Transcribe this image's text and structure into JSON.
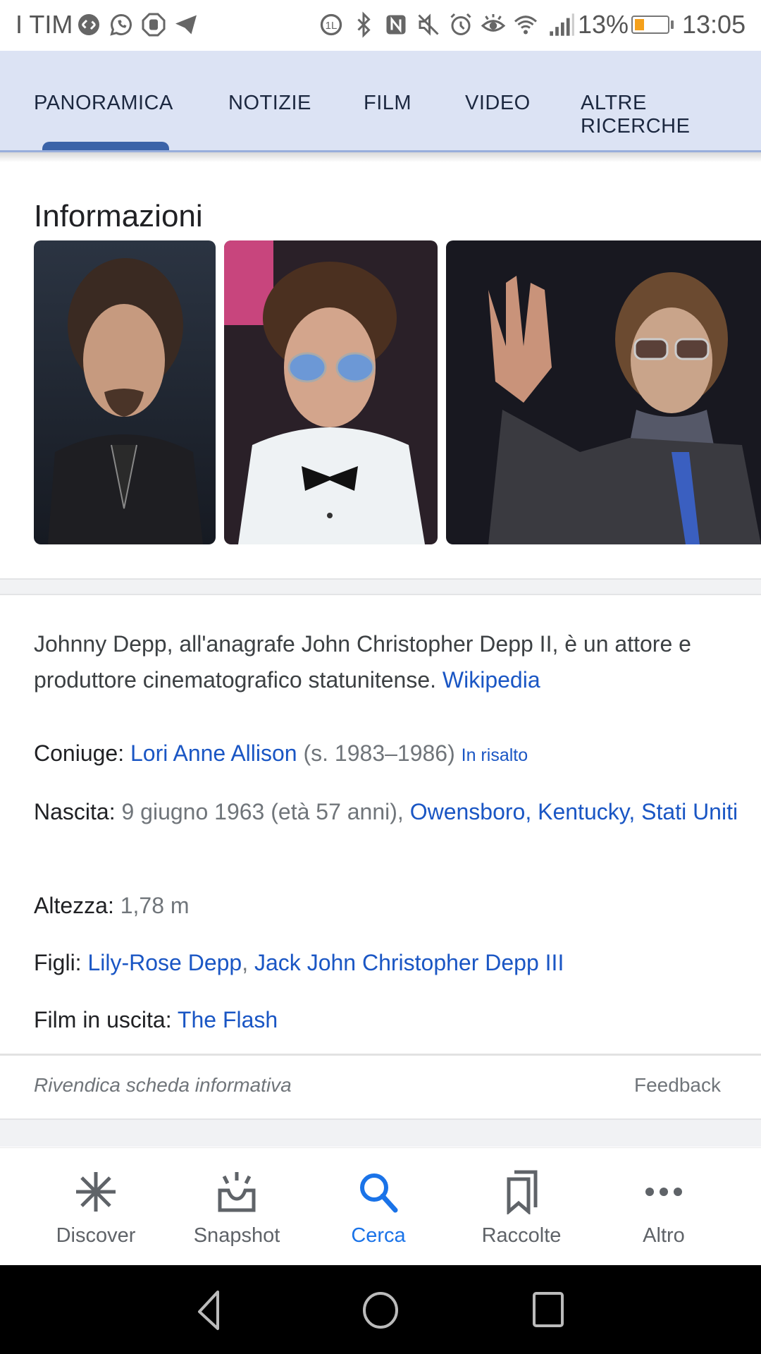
{
  "status_bar": {
    "carrier": "I TIM",
    "left_icons": [
      "shazam-icon",
      "whatsapp-icon",
      "adblock-hand-icon",
      "telegram-icon"
    ],
    "right_icons": [
      "data-saver-icon",
      "bluetooth-icon",
      "nfc-icon",
      "mute-icon",
      "alarm-icon",
      "eye-comfort-icon",
      "wifi-icon",
      "signal-icon"
    ],
    "battery_percent": "13%",
    "battery_level": 0.13,
    "battery_color": "#f5a01a",
    "time": "13:05"
  },
  "tabs": {
    "items": [
      {
        "label": "PANORAMICA",
        "active": true
      },
      {
        "label": "NOTIZIE",
        "active": false
      },
      {
        "label": "FILM",
        "active": false
      },
      {
        "label": "VIDEO",
        "active": false
      },
      {
        "label": "ALTRE RICERCHE",
        "active": false
      }
    ],
    "accent": "#3b63a8"
  },
  "info": {
    "title": "Informazioni",
    "photos": [
      {
        "alt": "Johnny Depp portrait, dark background"
      },
      {
        "alt": "Johnny Depp in white tuxedo with blue sunglasses"
      },
      {
        "alt": "Johnny Depp waving, wearing sunglasses and scarf"
      }
    ]
  },
  "description": {
    "text": "Johnny Depp, all'anagrafe John Christopher Depp II, è un attore e produttore cinematografico statunitense.",
    "source_link": "Wikipedia"
  },
  "facts": {
    "spouse": {
      "label": "Coniuge:",
      "name": "Lori Anne Allison",
      "years": "(s. 1983–1986)",
      "highlight": "In risalto"
    },
    "birth": {
      "label": "Nascita:",
      "date": "9 giugno 1963 (età 57 anni),",
      "place": "Owensboro, Kentucky, Stati Uniti"
    },
    "height": {
      "label": "Altezza:",
      "value": "1,78 m"
    },
    "children": {
      "label": "Figli:",
      "child1": "Lily-Rose Depp",
      "separator": ",",
      "child2": "Jack John Christopher Depp III"
    },
    "upcoming": {
      "label": "Film in uscita:",
      "film": "The Flash"
    }
  },
  "footer": {
    "claim": "Rivendica scheda informativa",
    "feedback": "Feedback"
  },
  "bottom_nav": {
    "items": [
      {
        "label": "Discover",
        "icon": "asterisk-icon",
        "active": false
      },
      {
        "label": "Snapshot",
        "icon": "snapshot-icon",
        "active": false
      },
      {
        "label": "Cerca",
        "icon": "search-icon",
        "active": true
      },
      {
        "label": "Raccolte",
        "icon": "bookmarks-icon",
        "active": false
      },
      {
        "label": "Altro",
        "icon": "more-icon",
        "active": false
      }
    ],
    "active_color": "#1a73e8"
  },
  "system_nav": {
    "buttons": [
      "back",
      "home",
      "recents"
    ]
  },
  "colors": {
    "link": "#1a56c4",
    "tab_background": "#dce3f4"
  }
}
